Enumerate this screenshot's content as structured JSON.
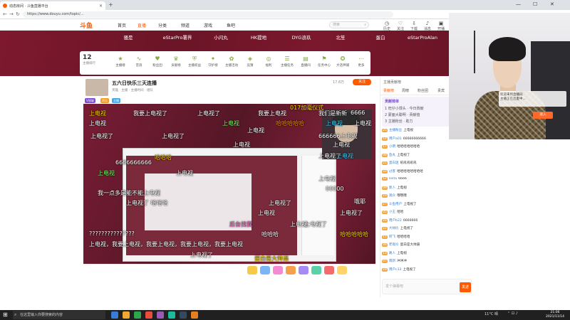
{
  "browser": {
    "tab_title": "动态房间 · 斗鱼直播平台",
    "url": "https://www.douyu.com/topic/...",
    "new_tab": "+",
    "minimize": "—",
    "maximize": "☐",
    "close": "✕"
  },
  "site": {
    "logo": "斗鱼",
    "nav": [
      "首页",
      "直播",
      "分类",
      "频道",
      "游戏",
      "鱼吧"
    ],
    "active_nav": "直播",
    "search_placeholder": "搜索",
    "header_icons": [
      "历史",
      "关注",
      "下载",
      "消息",
      "开播"
    ]
  },
  "band": {
    "items": [
      "骚是",
      "eStarPro署界",
      "小闪丸",
      "HK提地",
      "DYG浪玖",
      "北笙",
      "蛋白",
      "eStarProAlan"
    ]
  },
  "gift_row": {
    "rank": "12",
    "rank_label": "主播排行",
    "items": [
      "主播榜",
      "音浪",
      "粉丝团",
      "贡献榜",
      "主播权益",
      "守护榜",
      "主播活动",
      "竞猜",
      "福利",
      "主播任务",
      "直播间",
      "任务中心",
      "大话神捕",
      "主播礼物",
      "更多"
    ]
  },
  "room": {
    "title": "五六日快乐三天连播",
    "subtitle": "英雄 · 主播 · 主播时间 · 组队",
    "follow": "关注",
    "follow_count": "17.6万",
    "tags": [
      "V领域",
      "声乐",
      "主播",
      "主播",
      "主播"
    ]
  },
  "danmaku": [
    {
      "text": "上电视",
      "cls": "y"
    },
    {
      "text": "我要上电视了",
      "cls": ""
    },
    {
      "text": "上电视了",
      "cls": ""
    },
    {
      "text": "我要上电视",
      "cls": ""
    },
    {
      "text": "我们是新新",
      "cls": ""
    },
    {
      "text": "017加毫仪式",
      "cls": "y"
    },
    {
      "text": "6666",
      "cls": ""
    },
    {
      "text": "上电视",
      "cls": "g"
    },
    {
      "text": "上电视",
      "cls": ""
    },
    {
      "text": "哈哈哈哈哈",
      "cls": "o"
    },
    {
      "text": "上电视",
      "cls": "c"
    },
    {
      "text": "上电视",
      "cls": ""
    },
    {
      "text": "上电视",
      "cls": ""
    },
    {
      "text": "上电视了",
      "cls": ""
    },
    {
      "text": "上电视了",
      "cls": ""
    },
    {
      "text": "上电视",
      "cls": ""
    },
    {
      "text": "哈哈哈",
      "cls": "y"
    },
    {
      "text": "6666666666",
      "cls": ""
    },
    {
      "text": "上电视",
      "cls": ""
    },
    {
      "text": "上电视了",
      "cls": ""
    },
    {
      "text": "我一点多是能不能上电视",
      "cls": ""
    },
    {
      "text": "上电视了 哈哈哈",
      "cls": ""
    },
    {
      "text": "上电视",
      "cls": ""
    },
    {
      "text": "00000",
      "cls": ""
    },
    {
      "text": "上电视了",
      "cls": ""
    },
    {
      "text": "哦耶",
      "cls": ""
    },
    {
      "text": "上电视",
      "cls": ""
    },
    {
      "text": "上电视了",
      "cls": ""
    },
    {
      "text": "后台找我",
      "cls": "p"
    },
    {
      "text": "哈哈哈",
      "cls": ""
    },
    {
      "text": "上电视了",
      "cls": ""
    },
    {
      "text": "上电视，我要上电视，我要上电视，我要上电视，我要上电视",
      "cls": ""
    },
    {
      "text": "哈哈哈哈哈",
      "cls": "y"
    },
    {
      "text": "上电视",
      "cls": ""
    },
    {
      "text": "蛋白是大帅逼",
      "cls": "y"
    },
    {
      "text": "上电视了",
      "cls": ""
    },
    {
      "text": "???????????????",
      "cls": ""
    },
    {
      "text": "666666上电视",
      "cls": ""
    },
    {
      "text": "上电视",
      "cls": "c"
    },
    {
      "text": "上电视",
      "cls": ""
    },
    {
      "text": "上电视",
      "cls": "g"
    }
  ],
  "chat": {
    "top_label": "主播贡献榜",
    "tabs": [
      "贡献榜",
      "周榜",
      "粉丝团",
      "贵宾"
    ],
    "rank_title": "贡献榜单",
    "rank_lines": [
      "1 旺仔小馒头 · 今日贡献",
      "2 蒙面大聪明 · 贡献值",
      "3 主播粉丝 · 助力"
    ],
    "messages": [
      {
        "lv": "25",
        "name": "主播粉丝",
        "text": "上电视"
      },
      {
        "lv": "14",
        "name": "用户a01",
        "text": "66666666666"
      },
      {
        "lv": "17",
        "name": "小明",
        "text": "哈哈哈哈哈哈哈"
      },
      {
        "lv": "08",
        "name": "鱼丸",
        "text": "上电视了"
      },
      {
        "lv": "21",
        "name": "蛋白迷",
        "text": "吼吼吼吼吼"
      },
      {
        "lv": "33",
        "name": "过客",
        "text": "哈哈哈哈哈哈哈哈"
      },
      {
        "lv": "12",
        "name": "lolita",
        "text": "6666"
      },
      {
        "lv": "09",
        "name": "新人",
        "text": "上电视"
      },
      {
        "lv": "19",
        "name": "观众",
        "text": "哦哦哦"
      },
      {
        "lv": "27",
        "name": "斗鱼用户",
        "text": "上电视了"
      },
      {
        "lv": "05",
        "name": "小王",
        "text": "哈哈"
      },
      {
        "lv": "16",
        "name": "用户b22",
        "text": "6666666"
      },
      {
        "lv": "22",
        "name": "大帅比",
        "text": "上电视了"
      },
      {
        "lv": "11",
        "name": "阿飞",
        "text": "哈哈哈哈"
      },
      {
        "lv": "30",
        "name": "老观众",
        "text": "蛋白是大帅逼"
      },
      {
        "lv": "13",
        "name": "路人",
        "text": "上电视"
      },
      {
        "lv": "07",
        "name": "萌新",
        "text": "冲冲冲"
      },
      {
        "lv": "18",
        "name": "用户c33",
        "text": "上电视了"
      }
    ],
    "input_placeholder": "发个弹幕吧",
    "send": "发送"
  },
  "webcam_overlay": {
    "line1": "欢迎来到直播间",
    "line2": "主播正在连麦中...",
    "button": "进入"
  },
  "taskbar": {
    "search": "在这里输入你要搜索的内容",
    "weather": "11°C 晴",
    "time": "21:06",
    "date": "2021/11/14"
  }
}
